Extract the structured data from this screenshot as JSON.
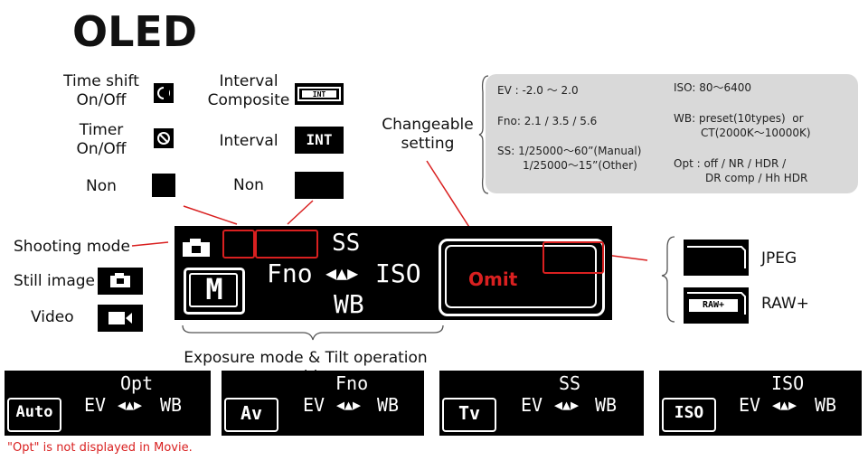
{
  "title": "OLED",
  "icons_left": {
    "time_shift": "Time shift\nOn/Off",
    "timer": "Timer\nOn/Off",
    "non": "Non"
  },
  "icons_right": {
    "interval_composite": "Interval\nComposite",
    "interval": "Interval",
    "interval_icon_text": "INT",
    "non": "Non"
  },
  "changeable_setting": "Changeable\nsetting",
  "settings_box": {
    "ev": "EV : -2.0 ～ 2.0",
    "fno": "Fno: 2.1 / 3.5 / 5.6",
    "ss_line1": "SS: 1/25000～60”(Manual)",
    "ss_line2": "1/25000～15”(Other)",
    "iso": "ISO: 80～6400",
    "wb_line1": "WB: preset(10types)  or",
    "wb_line2": "CT(2000K～10000K)",
    "opt_line1": "Opt : off / NR / HDR /",
    "opt_line2": "DR comp / Hh HDR"
  },
  "left_labels": {
    "shooting_mode": "Shooting mode",
    "still_image": "Still image",
    "video": "Video"
  },
  "main_screen": {
    "ss": "SS",
    "fno": "Fno",
    "arrows": "◀▲▶",
    "iso": "ISO",
    "wb": "WB",
    "mode_letter": "M",
    "omit": "Omit"
  },
  "right_labels": {
    "jpeg": "JPEG",
    "raw": "RAW+",
    "raw_icon_text": "RAW+"
  },
  "exposure_caption": "Exposure mode & Tilt operation guide",
  "mode_panels": [
    {
      "top": "Opt",
      "left": "EV",
      "right": "WB",
      "badge": "Auto"
    },
    {
      "top": "Fno",
      "left": "EV",
      "right": "WB",
      "badge": "Av"
    },
    {
      "top": "SS",
      "left": "EV",
      "right": "WB",
      "badge": "Tv"
    },
    {
      "top": "ISO",
      "left": "EV",
      "right": "WB",
      "badge": "ISO"
    }
  ],
  "note": "\"Opt\" is not displayed in Movie.",
  "colors": {
    "accent_red": "#d92020",
    "screen": "#000000",
    "settings_bg": "#d9d9d9"
  }
}
